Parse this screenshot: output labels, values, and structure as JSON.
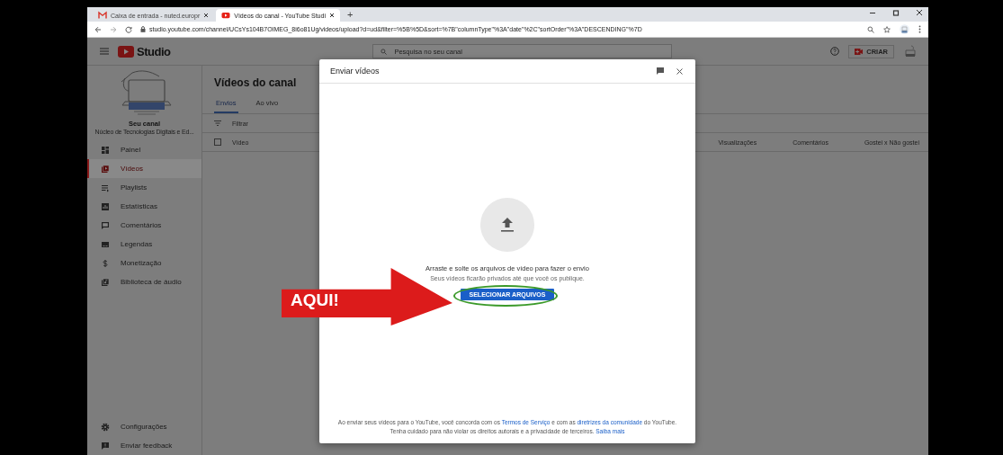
{
  "browser": {
    "tabs": [
      {
        "title": "Caixa de entrada - nuted.europr",
        "kind": "gmail",
        "selected": false
      },
      {
        "title": "Vídeos do canal - YouTube Studi",
        "kind": "youtube",
        "selected": true
      }
    ],
    "new_tab": "+",
    "url": "studio.youtube.com/channel/UCsYs104B7OIMEG_8i6o81Ug/videos/upload?d=ud&filter=%5B%5D&sort=%7B\"columnType\"%3A\"date\"%2C\"sortOrder\"%3A\"DESCENDING\"%7D"
  },
  "header": {
    "logo_text": "Studio",
    "search_placeholder": "Pesquisa no seu canal",
    "create_label": "CRIAR"
  },
  "sidebar": {
    "channel_label": "Seu canal",
    "channel_name": "Núcleo de Tecnologias Digitais e Ed...",
    "items": [
      {
        "label": "Painel",
        "kind": "dashboard",
        "selected": false
      },
      {
        "label": "Vídeos",
        "kind": "video",
        "selected": true
      },
      {
        "label": "Playlists",
        "kind": "playlist",
        "selected": false
      },
      {
        "label": "Estatísticas",
        "kind": "stats",
        "selected": false
      },
      {
        "label": "Comentários",
        "kind": "comments",
        "selected": false
      },
      {
        "label": "Legendas",
        "kind": "subtitles",
        "selected": false
      },
      {
        "label": "Monetização",
        "kind": "money",
        "selected": false
      },
      {
        "label": "Biblioteca de áudio",
        "kind": "audio",
        "selected": false
      }
    ],
    "footer_items": [
      {
        "label": "Configurações",
        "kind": "settings"
      },
      {
        "label": "Enviar feedback",
        "kind": "feedback"
      }
    ]
  },
  "content": {
    "title": "Vídeos do canal",
    "tabs": [
      {
        "label": "Envios",
        "selected": true
      },
      {
        "label": "Ao vivo",
        "selected": false
      }
    ],
    "filter_placeholder": "Filtrar",
    "select_all_checked": false,
    "columns": [
      "Vídeo",
      "Visualizações",
      "Comentários",
      "Gostei x Não gostei"
    ]
  },
  "dialog": {
    "title": "Enviar vídeos",
    "drop_text": "Arraste e solte os arquivos de vídeo para fazer o envio",
    "privacy_text": "Seus vídeos ficarão privados até que você os publique.",
    "button": "SELECIONAR ARQUIVOS",
    "legal": [
      [
        {
          "text": "Ao enviar seus vídeos para o YouTube, você concorda com os ",
          "link": false
        },
        {
          "text": "Termos de Serviço",
          "link": true
        },
        {
          "text": " e com as ",
          "link": false
        },
        {
          "text": "diretrizes da comunidade",
          "link": true
        },
        {
          "text": " do YouTube.",
          "link": false
        }
      ],
      [
        {
          "text": "Tenha cuidado para não violar os direitos autorais e a privacidade de terceiros. ",
          "link": false
        },
        {
          "text": "Saiba mais",
          "link": true
        }
      ]
    ]
  },
  "callout": {
    "text": "AQUI!"
  }
}
